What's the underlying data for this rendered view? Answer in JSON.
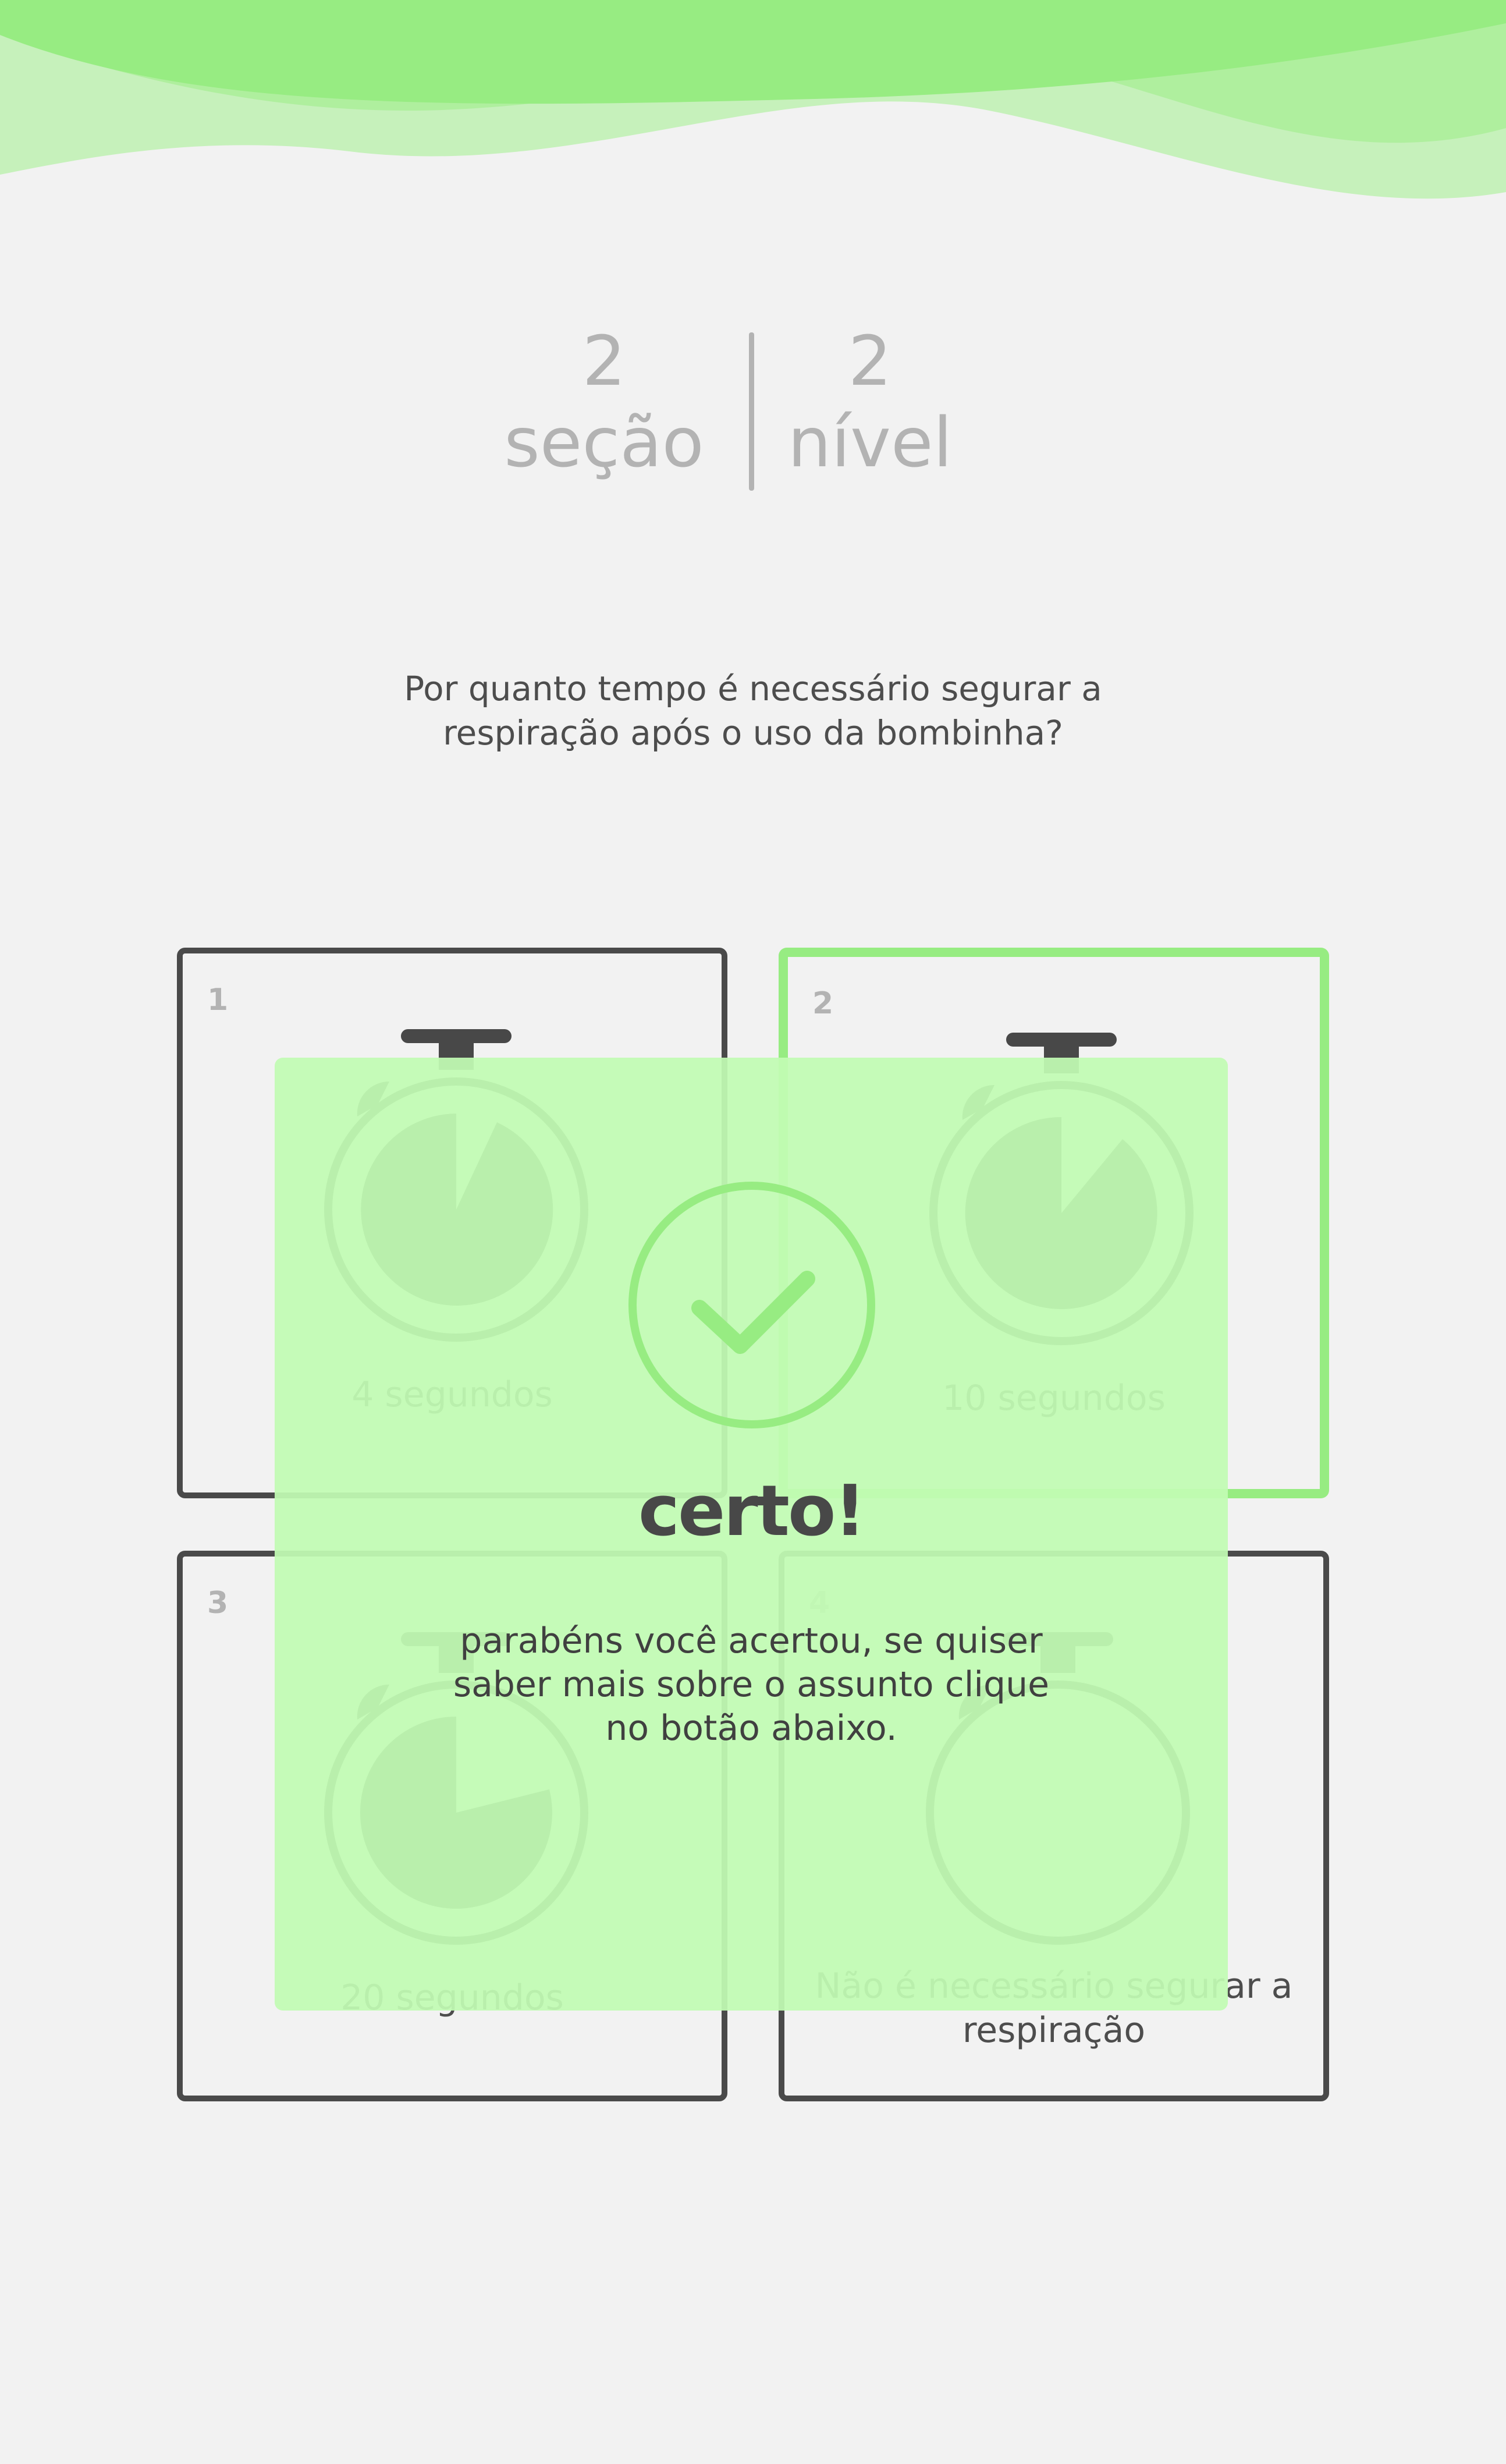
{
  "header": {
    "section_number": "2",
    "section_label": "seção",
    "level_number": "2",
    "level_label": "nível"
  },
  "question": "Por quanto tempo é necessário segurar a respiração após o uso da bombinha?",
  "options": [
    {
      "number": "1",
      "label": "4 segundos",
      "selected": false,
      "timer_icon": "stopwatch-icon"
    },
    {
      "number": "2",
      "label": "10 segundos",
      "selected": true,
      "timer_icon": "stopwatch-icon"
    },
    {
      "number": "3",
      "label": "20 segundos",
      "selected": false,
      "timer_icon": "stopwatch-icon"
    },
    {
      "number": "4",
      "label": "Não é necessário segurar a respiração",
      "selected": false,
      "timer_icon": "stopwatch-icon"
    }
  ],
  "feedback": {
    "icon": "check-circle-icon",
    "title": "certo!",
    "message": "parabéns você acertou,  se quiser saber mais sobre o assunto clique no botão abaixo."
  },
  "colors": {
    "accent_green": "#97ec82",
    "overlay_green": "#c2fcb4",
    "card_border": "#4a4a4a",
    "muted_text": "#b3b3b3",
    "background": "#f2f2f2"
  }
}
